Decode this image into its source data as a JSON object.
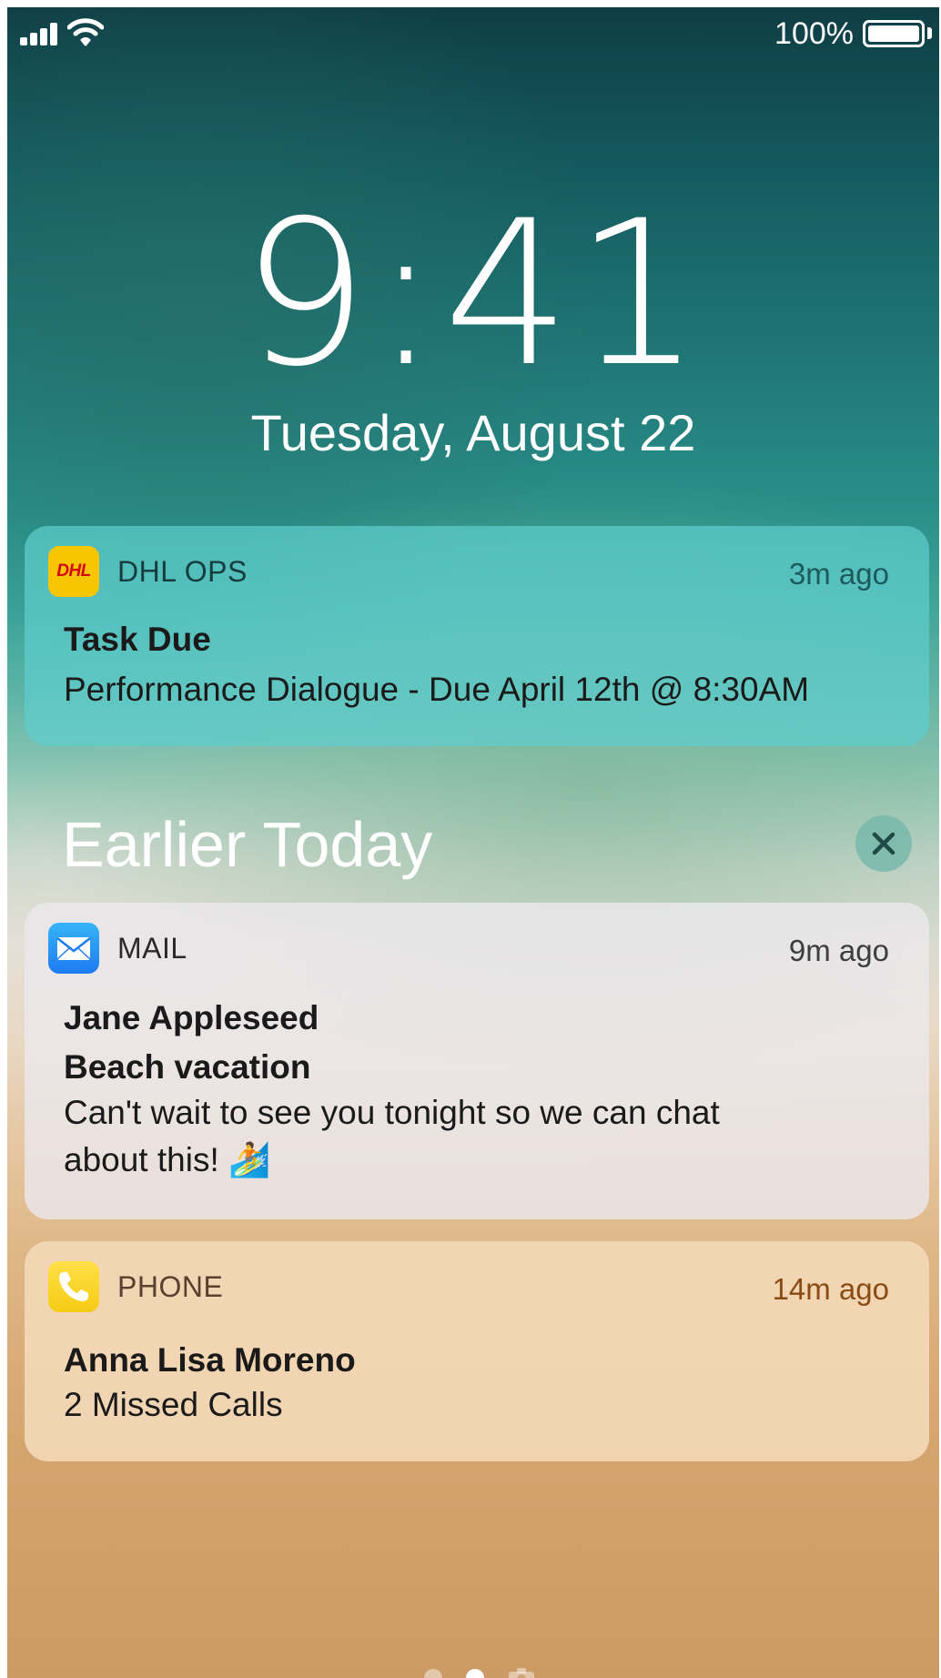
{
  "status_bar": {
    "battery_percent": "100%",
    "battery_level": 1.0,
    "signal_bars": 4,
    "signal_icon": "cellular-signal-icon",
    "wifi_icon": "wifi-icon"
  },
  "lock_screen": {
    "time": "9:41",
    "date": "Tuesday, August 22"
  },
  "notifications": [
    {
      "app": "DHL OPS",
      "icon": "dhl-app-icon",
      "icon_text": "DHL",
      "time": "3m ago",
      "title": "Task Due",
      "body": "Performance Dialogue - Due April 12th @ 8:30AM"
    }
  ],
  "earlier_today": {
    "section_title": "Earlier Today",
    "clear_icon": "close-icon",
    "notifications": [
      {
        "app": "MAIL",
        "icon": "mail-app-icon",
        "time": "9m ago",
        "sender": "Jane Appleseed",
        "subject": "Beach vacation",
        "body_line1": "Can't wait to see you tonight so we can chat",
        "body_line2": "about this! 🏄"
      },
      {
        "app": "PHONE",
        "icon": "phone-app-icon",
        "time": "14m ago",
        "title": "Anna Lisa Moreno",
        "body": "2 Missed Calls"
      }
    ]
  },
  "page_indicator": {
    "pages": 3,
    "current_page": 2,
    "last_icon": "camera-icon"
  },
  "colors": {
    "dhl_yellow": "#f7c600",
    "dhl_red": "#d40511",
    "mail_blue": "#1d7cf0",
    "phone_yellow": "#f5cb14",
    "phone_time_accent": "#8a4b14"
  }
}
